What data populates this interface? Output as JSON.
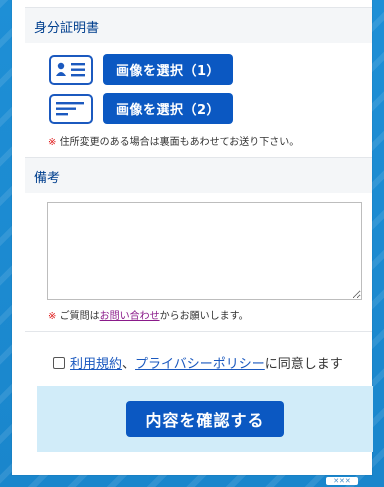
{
  "id_section": {
    "title": "身分証明書",
    "buttons": [
      "画像を選択（1）",
      "画像を選択（2）"
    ],
    "icons": [
      "id-card-front-icon",
      "id-card-back-icon"
    ],
    "note_mark": "※",
    "note": "住所変更のある場合は裏面もあわせてお送り下さい。"
  },
  "remarks_section": {
    "title": "備考",
    "textarea_value": "",
    "note_mark": "※",
    "note_prefix": "ご質問は",
    "note_link": "お問い合わせ",
    "note_suffix": "からお願いします。"
  },
  "agreement": {
    "checked": false,
    "terms_link": "利用規約",
    "separator": "、",
    "privacy_link": "プライバシーポリシー",
    "suffix": "に同意します"
  },
  "confirm": {
    "label": "内容を確認する"
  },
  "colors": {
    "accent": "#0b58c2",
    "section_title": "#003f8e",
    "confirm_area_bg": "#d1ecf9",
    "background": "#1c8ad0"
  },
  "ad_badge": {
    "label": "✕✕✕"
  }
}
